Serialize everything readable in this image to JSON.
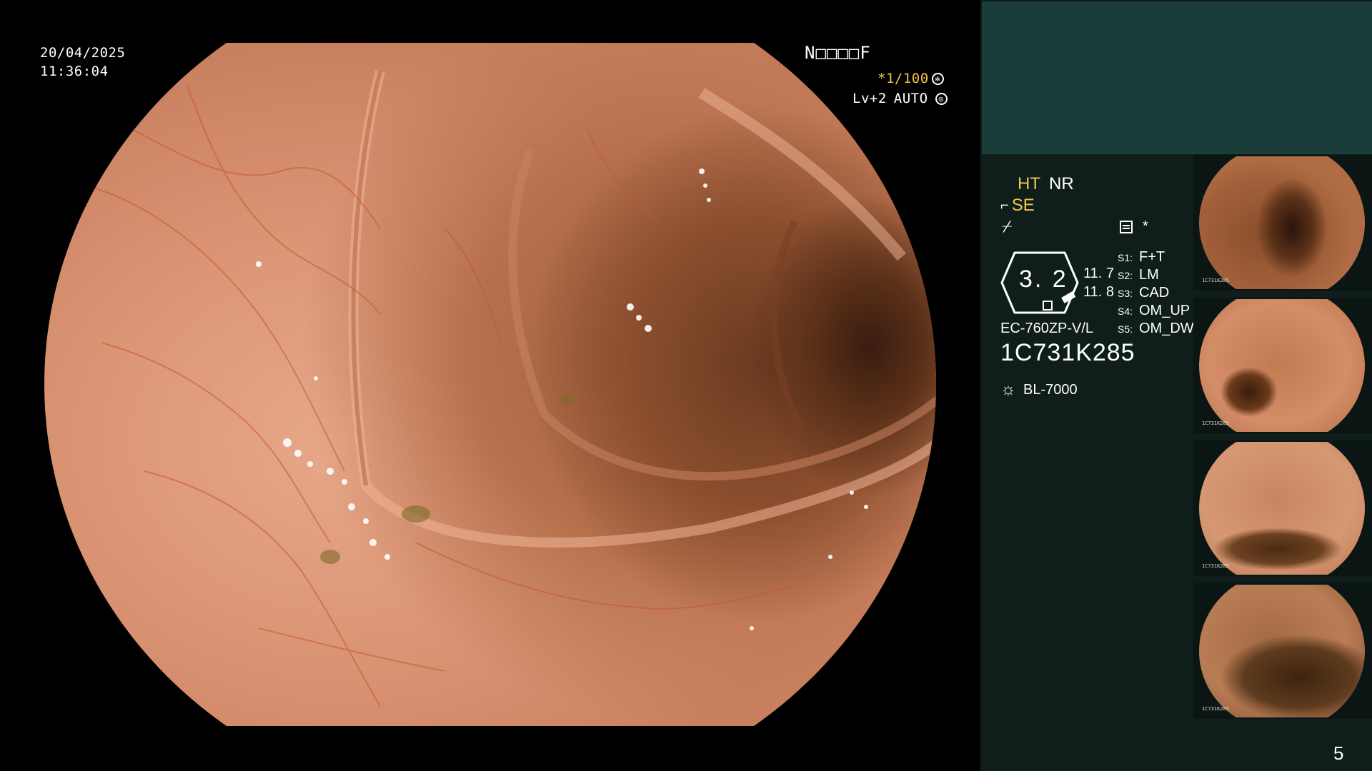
{
  "overlay": {
    "date": "20/04/2025",
    "time": "11:36:04",
    "patient_id": "N□□□□F",
    "shutter": "*1/100",
    "shutter_icon": "fan-icon",
    "level": "Lv+2",
    "iris_mode": "AUTO",
    "iris_icon": "iris-icon"
  },
  "panel": {
    "ht": "HT",
    "nr": "NR",
    "se": "SE",
    "se_icon": "structure-enhance-icon",
    "enhance_icon_glyph": "⌿",
    "memo_icon": "memo-icon",
    "asterisk": "*",
    "gauge_value": "3. 2",
    "gauge_right_1": "11. 7",
    "gauge_right_2": "11. 8",
    "scope_model": "EC-760ZP-V/L",
    "serial": "1C731K285",
    "light_icon": "lamp-icon",
    "light_source": "BL-7000",
    "switches": [
      {
        "key": "S1:",
        "value": "F+T"
      },
      {
        "key": "S2:",
        "value": "LM"
      },
      {
        "key": "S3:",
        "value": "CAD"
      },
      {
        "key": "S4:",
        "value": "OM_UP"
      },
      {
        "key": "S5:",
        "value": "OM_DW"
      }
    ],
    "thumbnails": [
      {
        "label": "1C731K285"
      },
      {
        "label": "1C731K285"
      },
      {
        "label": "1C731K285"
      },
      {
        "label": "1C731K285"
      }
    ],
    "image_count": "5"
  },
  "colors": {
    "accent_yellow": "#f3c54a",
    "panel_bg": "#0f1d1b",
    "panel_header": "#1b3d3a"
  }
}
